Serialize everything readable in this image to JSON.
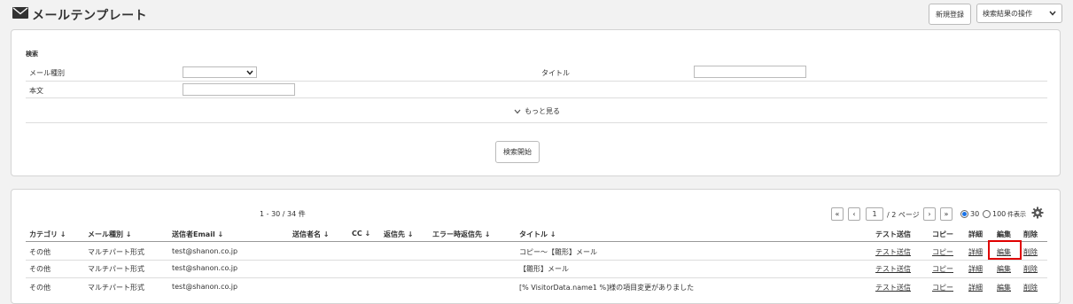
{
  "header": {
    "title": "メールテンプレート",
    "new_button": "新規登録",
    "ops_select": "検索結果の操作"
  },
  "search": {
    "heading": "検索",
    "mail_type_label": "メール種別",
    "mail_type_value": "",
    "title_label": "タイトル",
    "title_value": "",
    "body_label": "本文",
    "body_value": "",
    "more_label": "もっと見る",
    "start_button": "検索開始"
  },
  "results": {
    "count": "1 - 30 / 34 件",
    "pager": {
      "first": "«",
      "prev": "‹",
      "page": "1",
      "pages_suffix": "/ 2 ページ",
      "next": "›",
      "last": "»"
    },
    "per_page": {
      "opt30": "30",
      "opt100": "100",
      "suffix": "件表示",
      "selected": "30"
    },
    "columns": {
      "category": "カテゴリ ↓",
      "mail_type": "メール種別 ↓",
      "sender_email": "送信者Email ↓",
      "sender_name": "送信者名 ↓",
      "cc": "CC ↓",
      "to": "返信先 ↓",
      "error_to": "エラー時返信先 ↓",
      "title": "タイトル ↓",
      "test_send": "テスト送信",
      "copy": "コピー",
      "detail": "詳細",
      "edit": "編集",
      "delete": "削除"
    },
    "rows": [
      {
        "category": "その他",
        "mail_type": "マルチパート形式",
        "sender_email": "test@shanon.co.jp",
        "title": "コピー〜【雛形】メール",
        "test_send": "テスト送信",
        "copy": "コピー",
        "detail": "詳細",
        "edit": "編集",
        "delete": "削除"
      },
      {
        "category": "その他",
        "mail_type": "マルチパート形式",
        "sender_email": "test@shanon.co.jp",
        "title": "【雛形】メール",
        "test_send": "テスト送信",
        "copy": "コピー",
        "detail": "詳細",
        "edit": "編集",
        "delete": "削除"
      },
      {
        "category": "その他",
        "mail_type": "マルチパート形式",
        "sender_email": "test@shanon.co.jp",
        "title": "[% VisitorData.name1 %]様の項目変更がありました",
        "test_send": "テスト送信",
        "copy": "コピー",
        "detail": "詳細",
        "edit": "編集",
        "delete": "削除"
      }
    ]
  },
  "colors": {
    "highlight": "#e00000",
    "radio_selected": "#1a73e8"
  }
}
